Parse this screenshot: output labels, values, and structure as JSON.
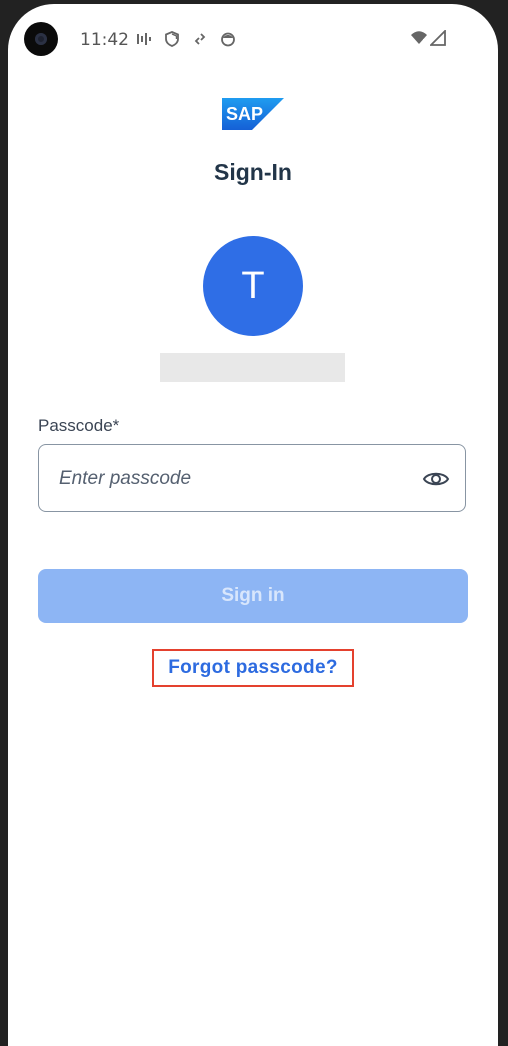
{
  "status_bar": {
    "time": "11:42",
    "icons": [
      "signal-bars-icon",
      "shield-icon",
      "link-icon",
      "face-icon",
      "wifi-icon",
      "cell-signal-icon"
    ]
  },
  "logo": {
    "text": "SAP"
  },
  "page": {
    "title": "Sign-In"
  },
  "avatar": {
    "initial": "T"
  },
  "passcode": {
    "label": "Passcode*",
    "placeholder": "Enter passcode",
    "value": ""
  },
  "actions": {
    "signin_label": "Sign in",
    "forgot_label": "Forgot passcode?"
  },
  "colors": {
    "accent": "#2f6ee6",
    "button_disabled": "#8db5f4",
    "link": "#2d6be0",
    "highlight_box": "#e4412e"
  }
}
